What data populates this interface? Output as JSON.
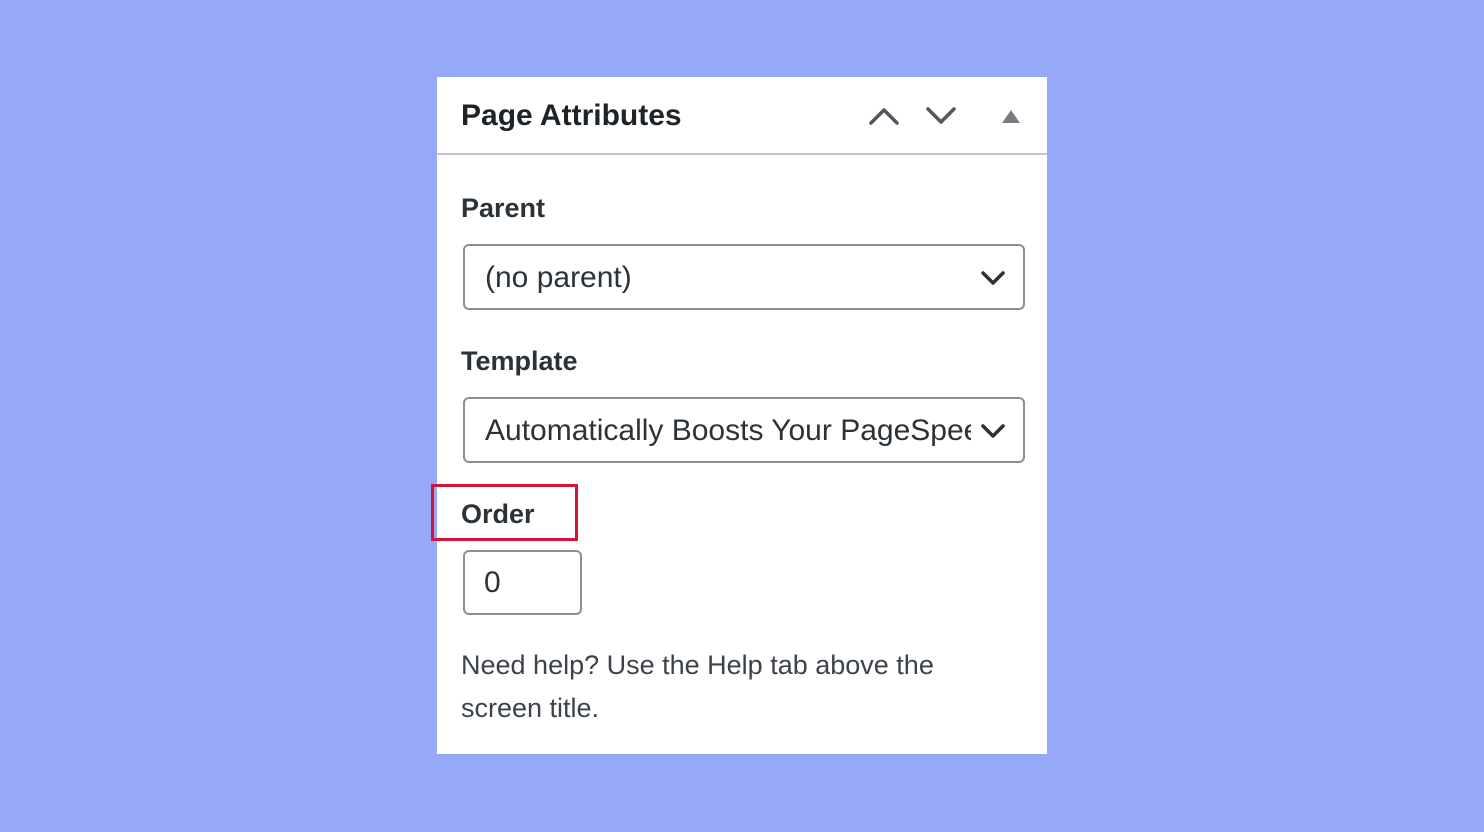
{
  "panel": {
    "title": "Page Attributes",
    "controls": {
      "move_up_icon": "chevron-up-icon",
      "move_down_icon": "chevron-down-icon",
      "toggle_icon": "triangle-up-icon"
    }
  },
  "parent": {
    "label": "Parent",
    "selected": "(no parent)"
  },
  "template": {
    "label": "Template",
    "selected": "Automatically Boosts Your PageSpeed"
  },
  "order": {
    "label": "Order",
    "value": "0"
  },
  "help": {
    "text": "Need help? Use the Help tab above the screen title."
  },
  "colors": {
    "background": "#96a8f8",
    "highlight": "#d2153a",
    "panel": "#ffffff",
    "border": "#8c8f94"
  }
}
